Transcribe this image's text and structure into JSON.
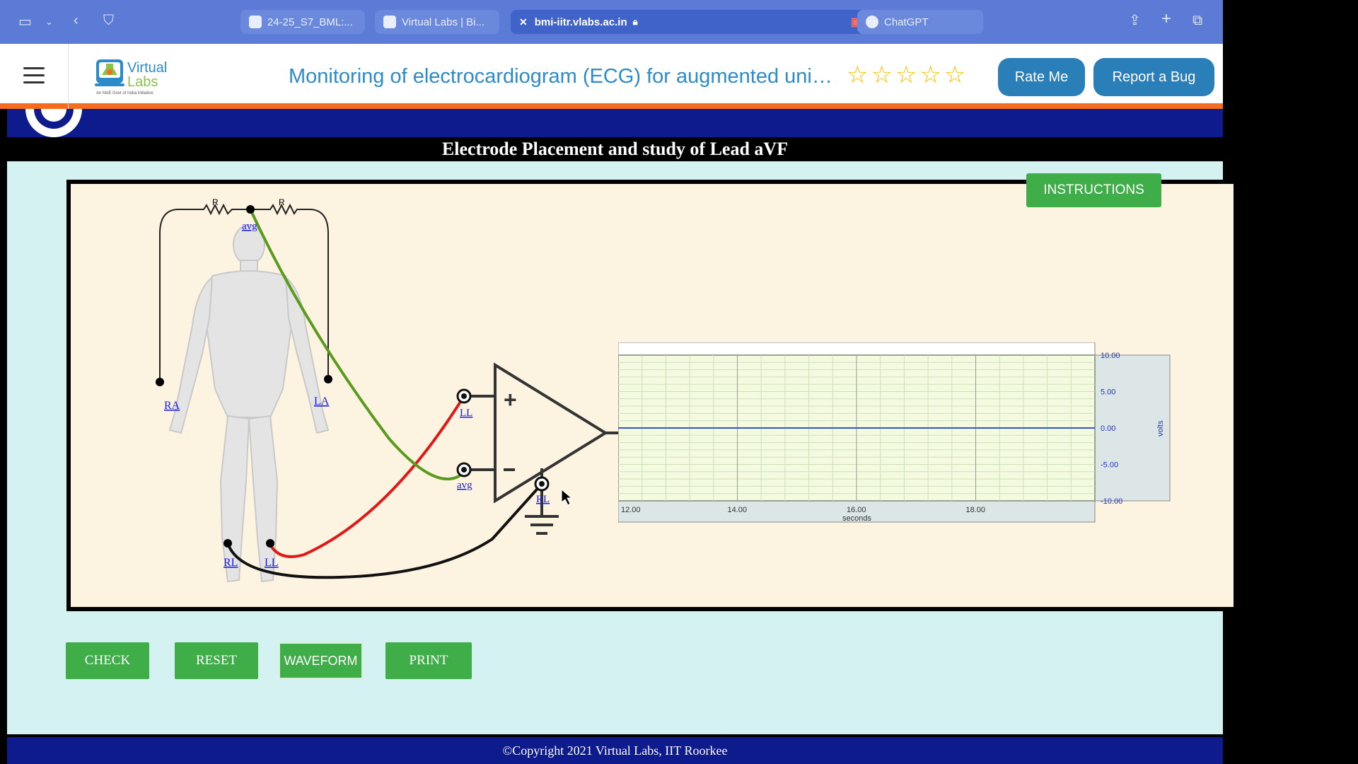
{
  "browser": {
    "tabs": [
      {
        "label": "24-25_S7_BML:...",
        "active": false
      },
      {
        "label": "Virtual Labs | Bi...",
        "active": false
      },
      {
        "label": "bmi-iitr.vlabs.ac.in",
        "active": true
      },
      {
        "label": "ChatGPT",
        "active": false
      }
    ]
  },
  "header": {
    "logo_text": "Virtual Labs",
    "logo_tagline": "An MoE Govt of India Initiative",
    "title": "Monitoring of electrocardiogram (ECG) for augmented unipolar lead aVF",
    "rating_stars": "☆☆☆☆☆",
    "rate_button": "Rate Me",
    "bug_button": "Report a Bug"
  },
  "experiment": {
    "heading": "Electrode Placement and study of Lead aVF",
    "instructions_button": "INSTRUCTIONS",
    "resistor_label": "R",
    "electrodes": {
      "ra": "RA",
      "la": "LA",
      "rl": "RL",
      "ll": "LL",
      "avg": "avg"
    },
    "amp_inputs": {
      "plus_label": "LL",
      "minus_label": "avg",
      "ground_label": "RL"
    }
  },
  "chart_data": {
    "type": "line",
    "title": "",
    "xlabel": "seconds",
    "ylabel": "volts",
    "xlim": [
      12,
      20
    ],
    "ylim": [
      -10,
      10
    ],
    "x_ticks": [
      "12.00",
      "14.00",
      "16.00",
      "18.00"
    ],
    "y_ticks": [
      "10.00",
      "5.00",
      "0.00",
      "-5.00",
      "-10.00"
    ],
    "grid": true,
    "series": [
      {
        "x": [
          12,
          20
        ],
        "values": [
          0,
          0
        ]
      }
    ]
  },
  "controls": {
    "check": "CHECK",
    "reset": "RESET",
    "waveform": "WAVEFORM",
    "print": "PRINT"
  },
  "footer": {
    "copyright": "©Copyright 2021 Virtual Labs, IIT Roorkee"
  },
  "colors": {
    "browser_bar": "#5b7bd6",
    "accent_green": "#3fae49",
    "title_blue": "#2d8bc9",
    "header_orange": "#f56c1d",
    "navy": "#0d1b8c",
    "wire_green": "#5a9a1e",
    "wire_red": "#e01818",
    "waveform": "#3355cc"
  }
}
